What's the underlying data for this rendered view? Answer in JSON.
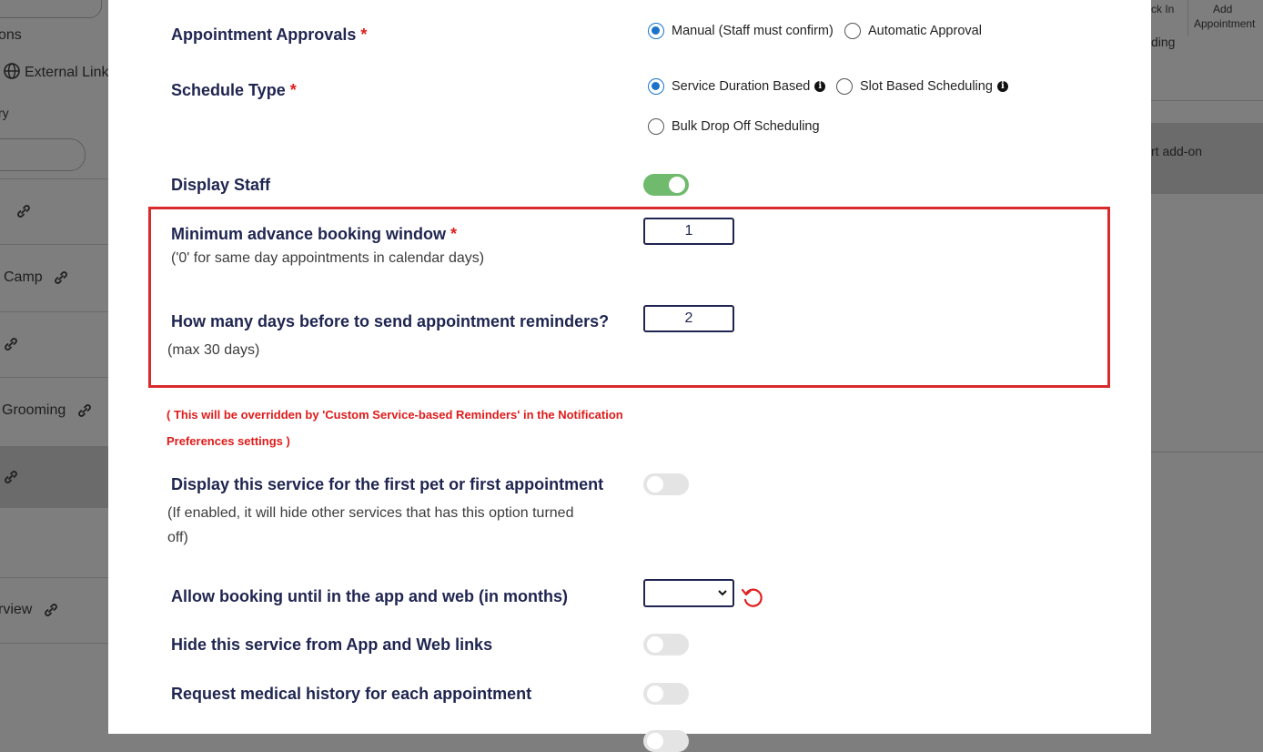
{
  "background_left": {
    "items": [
      "ons",
      "External Link",
      "ry",
      "Camp",
      "Grooming",
      "rview"
    ]
  },
  "background_right": {
    "check_in": "ck In",
    "add_appointment_line1": "Add",
    "add_appointment_line2": "Appointment",
    "top_fragment": "ding",
    "addon": "rt add-on"
  },
  "settings": {
    "appointment_approvals": {
      "label": "Appointment Approvals",
      "required": "*",
      "options": [
        "Manual (Staff must confirm)",
        "Automatic Approval"
      ],
      "selected": "Manual (Staff must confirm)"
    },
    "schedule_type": {
      "label": "Schedule Type",
      "required": "*",
      "options": [
        "Service Duration Based",
        "Slot Based Scheduling",
        "Bulk Drop Off Scheduling"
      ],
      "selected": "Service Duration Based"
    },
    "display_staff": {
      "label": "Display Staff",
      "enabled": true
    },
    "min_advance_booking": {
      "label": "Minimum advance booking window",
      "required": "*",
      "hint": "('0' for same day appointments in calendar days)",
      "value": "1"
    },
    "reminder_days": {
      "label": "How many days before to send appointment reminders?",
      "hint": "(max 30 days)",
      "value": "2"
    },
    "override_note_line1": "( This will be overridden by 'Custom Service-based Reminders' in the Notification",
    "override_note_line2": "Preferences settings )",
    "first_pet": {
      "label": "Display this service for the first pet or first appointment",
      "hint_line1": "(If enabled, it will hide other services that has this option turned",
      "hint_line2": "off)",
      "enabled": false
    },
    "allow_booking_until": {
      "label": "Allow booking until in the app and web (in months)",
      "value": ""
    },
    "hide_service": {
      "label": "Hide this service from App and Web links",
      "enabled": false
    },
    "medical_history": {
      "label": "Request medical history for each appointment",
      "enabled": false
    }
  },
  "colors": {
    "label": "#1f2550",
    "required": "#e02020",
    "radio_selected": "#1a73c9",
    "toggle_on": "#6fba6d",
    "highlight_border": "#d92b2b",
    "note": "#e01b1b"
  }
}
